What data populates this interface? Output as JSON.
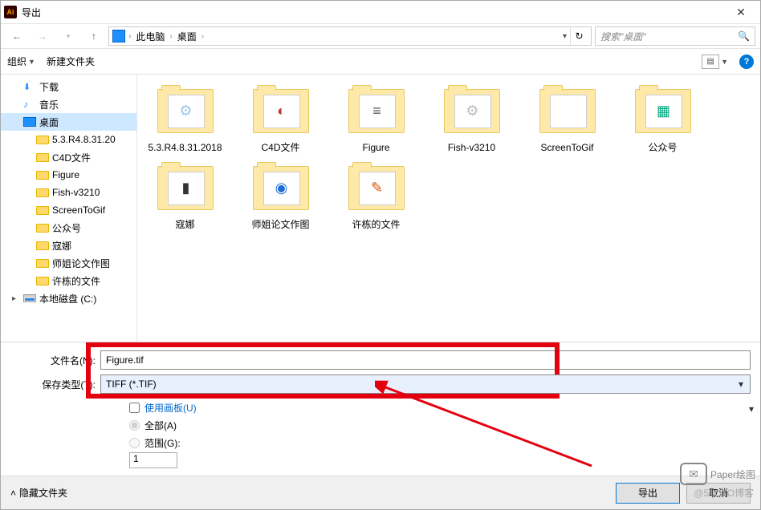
{
  "title": "导出",
  "app_icon_text": "Ai",
  "nav": {
    "path_segments": [
      "此电脑",
      "桌面"
    ],
    "search_placeholder": "搜索\"桌面\""
  },
  "toolbar": {
    "organize": "组织",
    "new_folder": "新建文件夹"
  },
  "sidebar": [
    {
      "icon": "dl",
      "label": "下载",
      "exp": ""
    },
    {
      "icon": "music",
      "label": "音乐",
      "exp": ""
    },
    {
      "icon": "desk",
      "label": "桌面",
      "sel": true,
      "exp": ""
    },
    {
      "icon": "folder",
      "label": "5.3.R4.8.31.20",
      "sub": true
    },
    {
      "icon": "folder",
      "label": "C4D文件",
      "sub": true
    },
    {
      "icon": "folder",
      "label": "Figure",
      "sub": true
    },
    {
      "icon": "folder",
      "label": "Fish-v3210",
      "sub": true
    },
    {
      "icon": "folder",
      "label": "ScreenToGif",
      "sub": true
    },
    {
      "icon": "folder",
      "label": "公众号",
      "sub": true
    },
    {
      "icon": "folder",
      "label": "寇娜",
      "sub": true
    },
    {
      "icon": "folder",
      "label": "师姐论文作图",
      "sub": true
    },
    {
      "icon": "folder",
      "label": "许栋的文件",
      "sub": true
    },
    {
      "icon": "disk",
      "label": "本地磁盘 (C:)",
      "exp": "▸"
    }
  ],
  "items": [
    {
      "label": "5.3.R4.8.31.2018",
      "color": "#9fc5e8",
      "glyph": "⚙"
    },
    {
      "label": "C4D文件",
      "color": "#c0392b",
      "glyph": "◐"
    },
    {
      "label": "Figure",
      "color": "#555",
      "glyph": "≡"
    },
    {
      "label": "Fish-v3210",
      "color": "#bbb",
      "glyph": "⚙"
    },
    {
      "label": "ScreenToGif",
      "color": "#f5d060",
      "glyph": ""
    },
    {
      "label": "公众号",
      "color": "#00a67d",
      "glyph": "▦"
    },
    {
      "label": "寇娜",
      "color": "#333",
      "glyph": "▮"
    },
    {
      "label": "师姐论文作图",
      "color": "#1e6bd6",
      "glyph": "◉"
    },
    {
      "label": "许栋的文件",
      "color": "#d35400",
      "glyph": "✎"
    }
  ],
  "form": {
    "filename_label": "文件名(N):",
    "filename_value": "Figure.tif",
    "type_label": "保存类型(T):",
    "type_value": "TIFF (*.TIF)",
    "use_artboard": "使用画板(U)",
    "all": "全部(A)",
    "range": "范围(G):",
    "range_value": "1"
  },
  "footer": {
    "hide_folders": "隐藏文件夹",
    "export": "导出",
    "cancel": "取消"
  },
  "watermark": {
    "main": "Paper绘图",
    "sub": "@51CTO博客"
  }
}
